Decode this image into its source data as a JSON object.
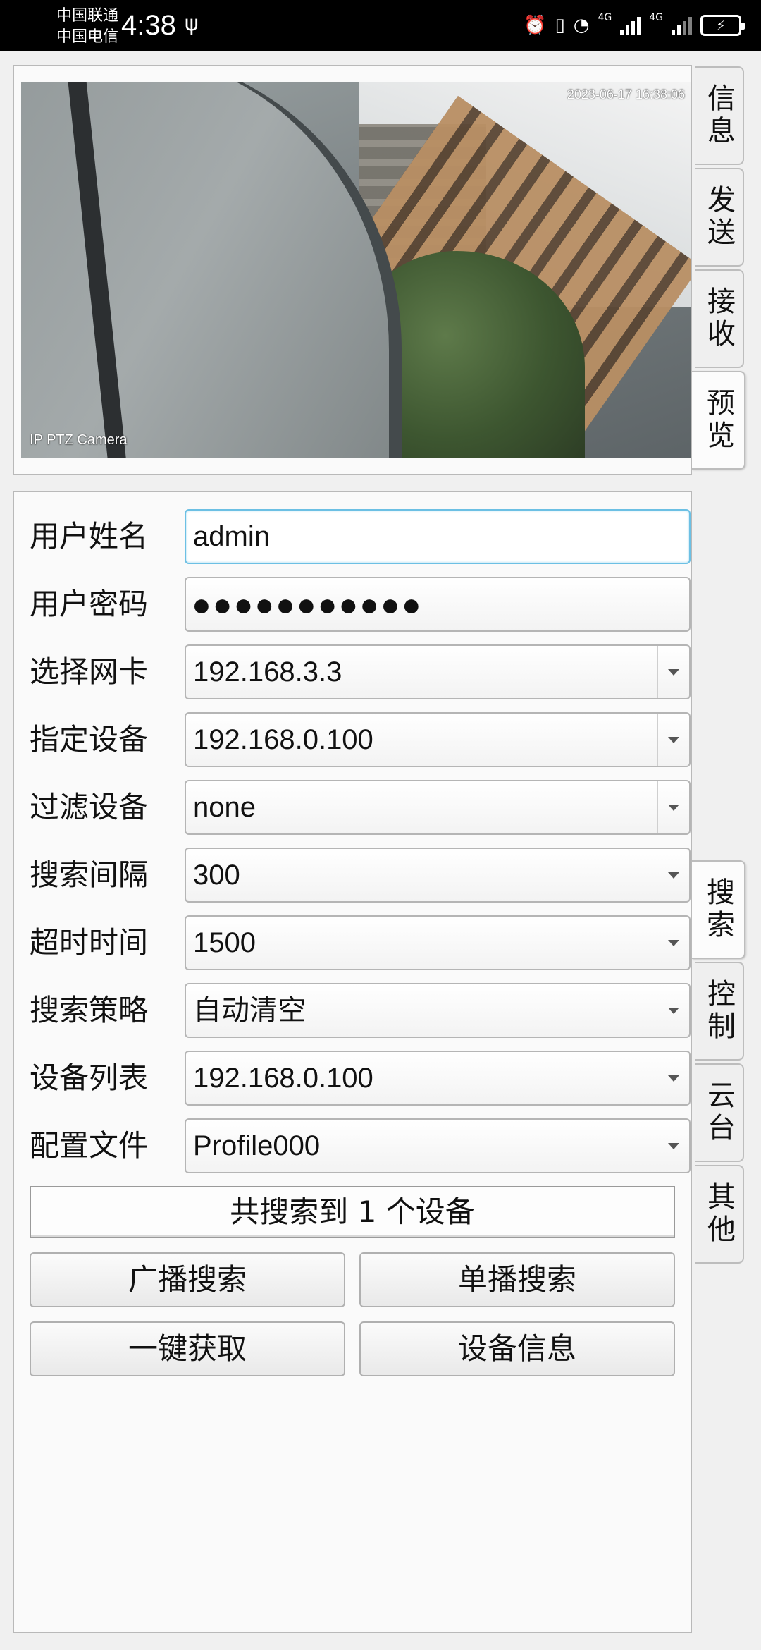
{
  "status_bar": {
    "carrier1": "中国联通",
    "carrier2": "中国电信",
    "time": "4:38",
    "usb_icon": "usb-icon",
    "net1": "4G",
    "net2": "4G"
  },
  "preview": {
    "osd_time": "2023-06-17 16:38:06",
    "osd_name": "IP PTZ Camera"
  },
  "top_tabs": [
    "信息",
    "发送",
    "接收",
    "预览"
  ],
  "side_tabs": [
    "搜索",
    "控制",
    "云台",
    "其他"
  ],
  "form": {
    "username_label": "用户姓名",
    "username_value": "admin",
    "password_label": "用户密码",
    "password_value": "●●●●●●●●●●●",
    "nic_label": "选择网卡",
    "nic_value": "192.168.3.3",
    "device_label": "指定设备",
    "device_value": "192.168.0.100",
    "filter_label": "过滤设备",
    "filter_value": "none",
    "interval_label": "搜索间隔",
    "interval_value": "300",
    "timeout_label": "超时时间",
    "timeout_value": "1500",
    "strategy_label": "搜索策略",
    "strategy_value": "自动清空",
    "list_label": "设备列表",
    "list_value": "192.168.0.100",
    "profile_label": "配置文件",
    "profile_value": "Profile000"
  },
  "result_text": "共搜索到 1 个设备",
  "buttons": {
    "broadcast": "广播搜索",
    "unicast": "单播搜索",
    "fetch": "一键获取",
    "info": "设备信息"
  }
}
